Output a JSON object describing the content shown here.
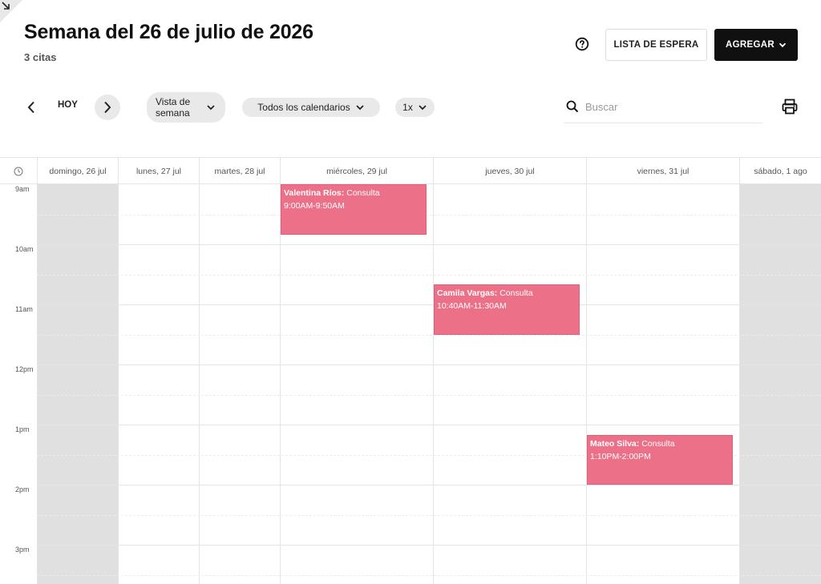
{
  "header": {
    "title": "Semana del 26 de julio de 2026",
    "subtitle": "3 citas"
  },
  "actions": {
    "waitlist_label": "LISTA DE ESPERA",
    "add_label": "AGREGAR"
  },
  "toolbar": {
    "today_label": "HOY",
    "view_line1": "Vista de",
    "view_line2": "semana",
    "calendars_label": "Todos los calendarios",
    "zoom_label": "1x",
    "search_placeholder": "Buscar"
  },
  "days": [
    {
      "label": "domingo, 26 jul",
      "weekend": true
    },
    {
      "label": "lunes, 27 jul",
      "weekend": false
    },
    {
      "label": "martes, 28 jul",
      "weekend": false
    },
    {
      "label": "miércoles, 29 jul",
      "weekend": false
    },
    {
      "label": "jueves, 30 jul",
      "weekend": false
    },
    {
      "label": "viernes, 31 jul",
      "weekend": false
    },
    {
      "label": "sábado, 1 ago",
      "weekend": true
    }
  ],
  "hours": [
    "9am",
    "10am",
    "11am",
    "12pm",
    "1pm",
    "2pm",
    "3pm"
  ],
  "events": [
    {
      "client": "Valentina Ríos:",
      "service": "Consulta",
      "time": "9:00AM-9:50AM",
      "day": "miércoles, 29 jul"
    },
    {
      "client": "Camila Vargas:",
      "service": "Consulta",
      "time": "10:40AM-11:30AM",
      "day": "jueves, 30 jul"
    },
    {
      "client": "Mateo Silva:",
      "service": "Consulta",
      "time": "1:10PM-2:00PM",
      "day": "viernes, 31 jul"
    }
  ],
  "colors": {
    "event": "#ec7188",
    "weekend": "#e0e0e0",
    "primary_button": "#101010"
  },
  "icons": {
    "help": "question-circle-icon",
    "prev": "chevron-left-icon",
    "next": "chevron-right-icon",
    "search": "search-icon",
    "print": "printer-icon",
    "clock": "clock-icon"
  }
}
